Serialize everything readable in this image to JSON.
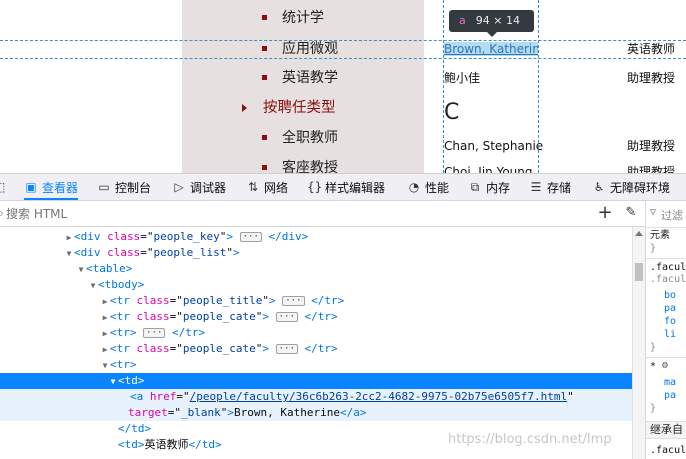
{
  "sidebar": {
    "items": [
      {
        "label": "统计学",
        "kind": "item"
      },
      {
        "label": "应用微观",
        "kind": "item"
      },
      {
        "label": "英语教学",
        "kind": "item"
      },
      {
        "label": "按聘任类型",
        "kind": "category"
      },
      {
        "label": "全职教师",
        "kind": "item"
      },
      {
        "label": "客座教授",
        "kind": "item"
      }
    ]
  },
  "content": {
    "rows": [
      {
        "name": "Brown, Katherine",
        "title": "英语教师"
      },
      {
        "name": "鲍小佳",
        "title": "助理教授"
      },
      {
        "letter": "C"
      },
      {
        "name": "Chan, Stephanie",
        "title": "助理教授"
      },
      {
        "name": "Choi, Jin Young",
        "title": "助理教授"
      }
    ]
  },
  "tooltip": {
    "tag": "a",
    "dimensions": "94 × 14"
  },
  "toolbar": {
    "tabs": [
      {
        "label": "查看器",
        "icon": "inspector-icon",
        "active": true
      },
      {
        "label": "控制台",
        "icon": "console-icon"
      },
      {
        "label": "调试器",
        "icon": "debugger-icon"
      },
      {
        "label": "网络",
        "icon": "network-icon"
      },
      {
        "label": "样式编辑器",
        "icon": "style-editor-icon"
      },
      {
        "label": "性能",
        "icon": "performance-icon"
      },
      {
        "label": "内存",
        "icon": "memory-icon"
      },
      {
        "label": "存储",
        "icon": "storage-icon"
      },
      {
        "label": "无障碍环境",
        "icon": "accessibility-icon"
      }
    ]
  },
  "search": {
    "placeholder": "搜索 HTML"
  },
  "rules_panel": {
    "filter": "过滤",
    "element_label": "元素",
    "selector1": ".facul",
    "selector1b": ".facul",
    "props1": [
      "bo",
      "pa",
      "fo",
      "li"
    ],
    "selector2": "*",
    "props2": [
      "ma",
      "pa"
    ],
    "inherited": "继承自",
    "selector3": ".facul"
  },
  "tree": {
    "rows": [
      {
        "indent": 64,
        "tw": "right",
        "tag": "div",
        "cls": "people_key",
        "collapsed": true,
        "close": "div"
      },
      {
        "indent": 64,
        "tw": "down",
        "tag": "div",
        "cls": "people_list"
      },
      {
        "indent": 76,
        "tw": "down",
        "tag": "table"
      },
      {
        "indent": 88,
        "tw": "down",
        "tag": "tbody"
      },
      {
        "indent": 100,
        "tw": "right",
        "tag": "tr",
        "cls": "people_title",
        "collapsed": true,
        "close": "tr"
      },
      {
        "indent": 100,
        "tw": "right",
        "tag": "tr",
        "cls": "people_cate",
        "collapsed": true,
        "close": "tr"
      },
      {
        "indent": 100,
        "tw": "right",
        "tag": "tr",
        "collapsed": true,
        "close": "tr"
      },
      {
        "indent": 100,
        "tw": "right",
        "tag": "tr",
        "cls": "people_cate",
        "collapsed": true,
        "close": "tr"
      },
      {
        "indent": 100,
        "tw": "down",
        "tag": "tr"
      }
    ],
    "selected_tag": "td",
    "link_href": "/people/faculty/36c6b263-2cc2-4682-9975-02b75e6505f7.html",
    "link_target": "_blank",
    "link_text": "Brown, Katherine",
    "close_td": "</td>",
    "next_td_open": "<td>",
    "next_td_text": "英语教师",
    "next_td_close": "</td>"
  },
  "watermark": "https://blog.csdn.net/lmp"
}
